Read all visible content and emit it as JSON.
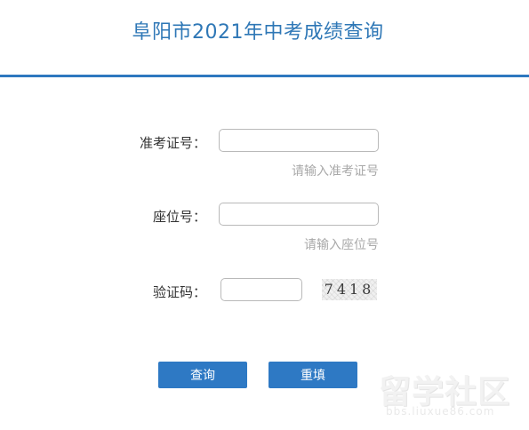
{
  "header": {
    "title": "阜阳市2021年中考成绩查询"
  },
  "form": {
    "exam_number": {
      "label": "准考证号：",
      "value": "",
      "hint": "请输入准考证号"
    },
    "seat_number": {
      "label": "座位号：",
      "value": "",
      "hint": "请输入座位号"
    },
    "verification_code": {
      "label": "验证码：",
      "value": "",
      "captcha_text": "7418"
    }
  },
  "buttons": {
    "query_label": "查询",
    "reset_label": "重填"
  },
  "watermark": {
    "text": "留学社区",
    "url": "bbs.liuxue86.com"
  },
  "colors": {
    "accent": "#2e78bf",
    "title": "#2e77b6",
    "button": "#2e79c4",
    "hint": "#a9a9a9"
  }
}
